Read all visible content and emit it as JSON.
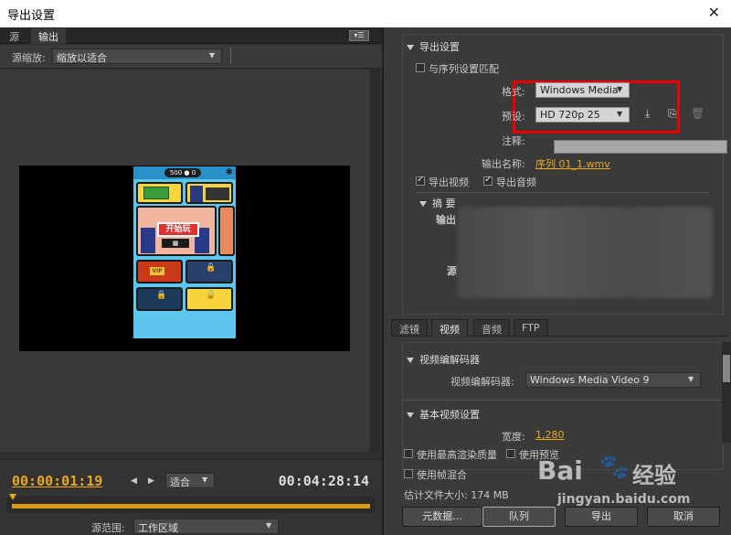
{
  "window": {
    "title": "导出设置",
    "close_glyph": "✕"
  },
  "left_tabs": [
    "源",
    "输出"
  ],
  "source_scale": {
    "label": "源缩放:",
    "value": "缩放以适合"
  },
  "preview": {
    "start_text": "开始玩",
    "coin_text": "500 ● 0",
    "vip_text": "VIP"
  },
  "timeline": {
    "current": "00:00:01:19",
    "fit": "适合",
    "duration": "00:04:28:14",
    "range_label": "源范围:",
    "range_value": "工作区域"
  },
  "export_settings": {
    "section_title": "导出设置",
    "match_sequence": "与序列设置匹配",
    "format_label": "格式:",
    "format_value": "Windows Media",
    "preset_label": "预设:",
    "preset_value": "HD 720p 25",
    "comment_label": "注释:",
    "output_name_label": "输出名称:",
    "output_name_value": "序列 01_1.wmv",
    "export_video": "导出视频",
    "export_audio": "导出音频",
    "summary_title": "摘 要",
    "summary_output": "输出",
    "summary_source": "源"
  },
  "sub_tabs": [
    "滤镜",
    "视频",
    "音频",
    "FTP"
  ],
  "video_codec": {
    "section_title": "视频编解码器",
    "codec_label": "视频编解码器:",
    "codec_value": "Windows Media Video 9",
    "basic_title": "基本视频设置",
    "width_label": "宽度:",
    "width_value": "1,280"
  },
  "bottom": {
    "max_render_quality": "使用最高渲染质量",
    "use_preview": "使用预览",
    "frame_blending": "使用帧混合",
    "file_size": "估计文件大小: 174 MB",
    "metadata_btn": "元数据...",
    "queue_btn": "队列",
    "export_btn": "导出",
    "cancel_btn": "取消"
  },
  "watermark": {
    "brand": "Bai",
    "brand2": "经验",
    "url": "jingyan.baidu.com"
  },
  "colors": {
    "accent": "#e8a81c",
    "highlight_box": "#e00000"
  }
}
